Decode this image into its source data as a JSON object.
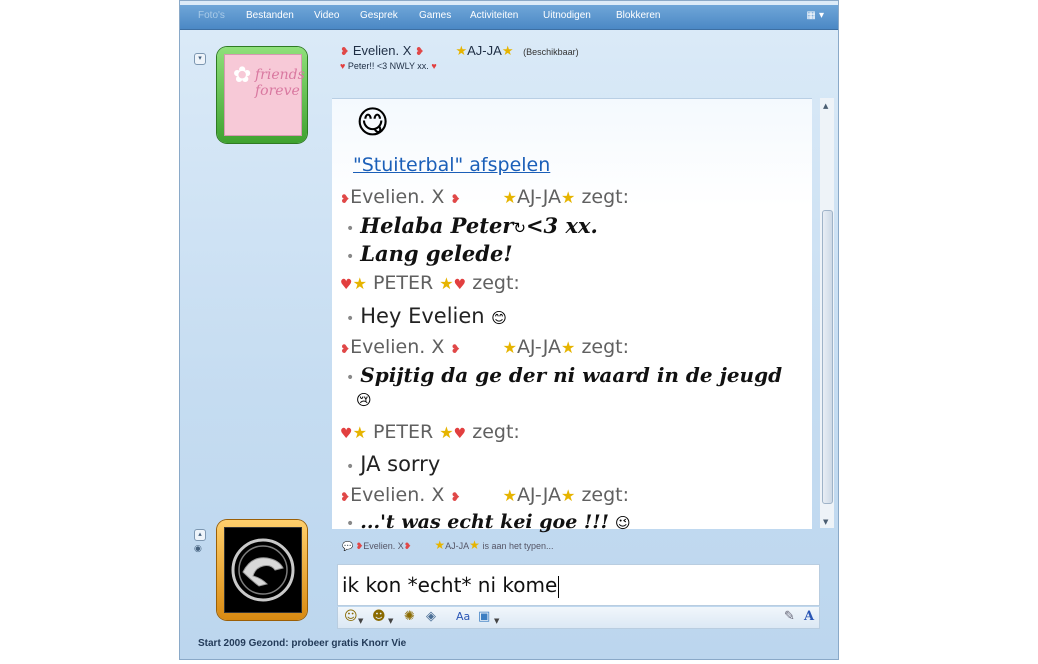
{
  "menubar": {
    "items": [
      "Foto's",
      "Bestanden",
      "Video",
      "Gesprek",
      "Games",
      "Activiteiten",
      "Uitnodigen",
      "Blokkeren"
    ]
  },
  "contact": {
    "name_left": "Evelien. X",
    "name_right": "AJ-JA",
    "status": "(Beschikbaar)",
    "personal_message": "Peter!!  <3 NWLY xx."
  },
  "chat": {
    "link": "\"Stuiterbal\" afspelen",
    "zegt": "zegt:",
    "sender_evelien_left": "Evelien. X",
    "sender_evelien_right": "AJ-JA",
    "sender_peter": "PETER",
    "messages": {
      "m1": "Helaba Peter",
      "m1_tail": "<3 xx.",
      "m2": "Lang gelede!",
      "m3": "Hey Evelien",
      "m4": "Spijtig da ge der ni waard in de jeugd",
      "m5": "JA sorry",
      "m6": "...'t was echt kei goe !!!"
    }
  },
  "typing": {
    "name_left": "Evelien. X",
    "name_right": "AJ-JA",
    "text": "is aan het typen..."
  },
  "input": {
    "value": "ik kon *echt* ni kome"
  },
  "footer": {
    "ad_text": "Start 2009 Gezond: probeer gratis Knorr Vie"
  },
  "colors": {
    "menubar": "#4b88c5",
    "link": "#1b5fb8",
    "sender_text": "#606060"
  }
}
